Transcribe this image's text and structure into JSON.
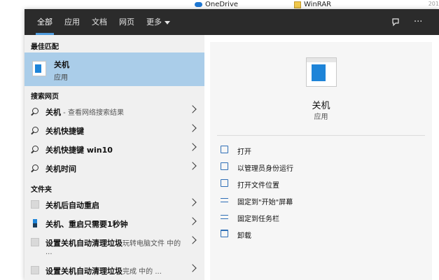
{
  "background": {
    "onedrive": "OneDrive",
    "winrar": "WinRAR",
    "edge_year": "201"
  },
  "tabs": [
    {
      "label": "全部",
      "active": true
    },
    {
      "label": "应用",
      "active": false
    },
    {
      "label": "文档",
      "active": false
    },
    {
      "label": "网页",
      "active": false
    },
    {
      "label": "更多",
      "active": false
    }
  ],
  "top_icons": {
    "feedback": "feedback-icon",
    "more": "···"
  },
  "best_match": {
    "section": "最佳匹配",
    "title": "关机",
    "subtitle": "应用"
  },
  "web_search": {
    "section": "搜索网页",
    "items": [
      {
        "label": "关机",
        "hint": " - 查看网络搜索结果"
      },
      {
        "label": "关机快捷键",
        "hint": ""
      },
      {
        "label": "关机快捷键 win10",
        "hint": ""
      },
      {
        "label": "关机时间",
        "hint": ""
      }
    ]
  },
  "folders": {
    "section": "文件夹",
    "items": [
      {
        "label": "关机后自动重启",
        "hint": ""
      },
      {
        "label": "关机、重启只需要1秒钟",
        "hint": ""
      },
      {
        "label": "设置关机自动清理垃圾",
        "hint": "玩转电脑文件 中的",
        "line2": "..."
      },
      {
        "label": "设置关机自动清理垃圾",
        "hint": "完成 中的 ..."
      }
    ]
  },
  "preview": {
    "title": "关机",
    "subtitle": "应用",
    "actions": [
      {
        "label": "打开",
        "icon": "open-icon"
      },
      {
        "label": "以管理员身份运行",
        "icon": "run-as-admin-icon"
      },
      {
        "label": "打开文件位置",
        "icon": "file-location-icon"
      },
      {
        "label": "固定到\"开始\"屏幕",
        "icon": "pin-start-icon"
      },
      {
        "label": "固定到任务栏",
        "icon": "pin-taskbar-icon"
      },
      {
        "label": "卸载",
        "icon": "uninstall-icon"
      }
    ]
  },
  "colors": {
    "topbar": "#2b2b2b",
    "accent": "#4f9bdc",
    "selection": "#aacde9",
    "app_blue": "#1e84d8"
  }
}
